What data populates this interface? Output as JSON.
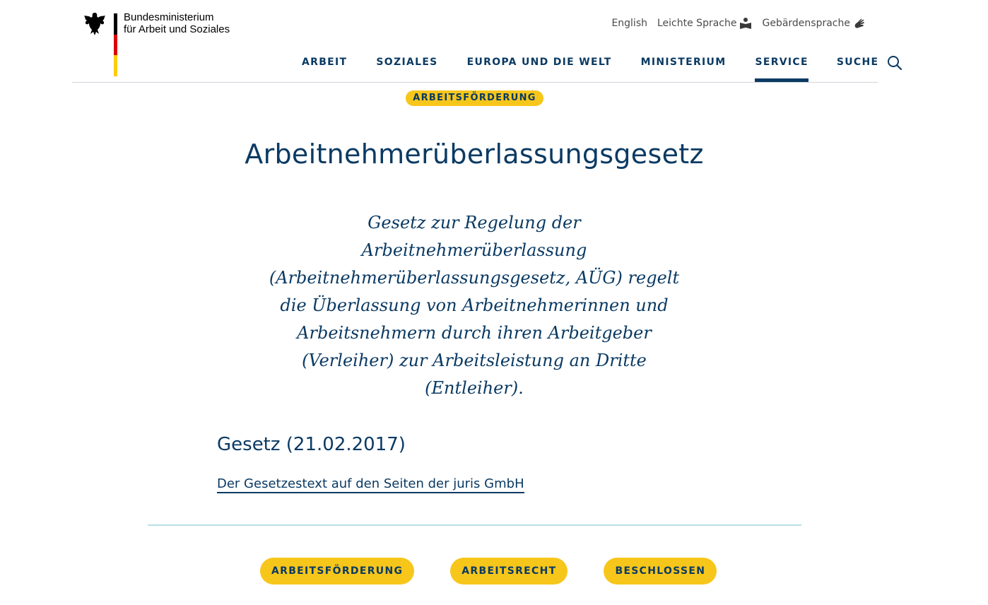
{
  "header": {
    "logo_line1": "Bundesministerium",
    "logo_line2": "für Arbeit und Soziales",
    "lang_links": [
      {
        "label": "English",
        "icon": ""
      },
      {
        "label": "Leichte Sprache",
        "icon": "easy-language-icon"
      },
      {
        "label": "Gebärdensprache",
        "icon": "sign-language-icon"
      }
    ],
    "nav": [
      {
        "label": "ARBEIT"
      },
      {
        "label": "SOZIALES"
      },
      {
        "label": "EUROPA UND DIE WELT"
      },
      {
        "label": "MINISTERIUM"
      },
      {
        "label": "SERVICE",
        "active": true
      },
      {
        "label": "SUCHE"
      }
    ]
  },
  "main": {
    "top_tag": "ARBEITSFÖRDERUNG",
    "title": "Arbeitnehmerüberlassungsgesetz",
    "intro": "Gesetz zur Regelung der Arbeitnehmerüberlassung (Arbeitnehmerüberlassungsgesetz, AÜG) regelt die Überlassung von Arbeitnehmerinnen und Arbeitsnehmern durch ihren Arbeitgeber (Verleiher) zur Arbeitsleistung an Dritte (Entleiher).",
    "law_heading": "Gesetz (21.02.2017)",
    "law_link": "Der Gesetzestext auf den Seiten der juris GmbH",
    "tags": [
      "ARBEITSFÖRDERUNG",
      "ARBEITSRECHT",
      "BESCHLOSSEN"
    ]
  },
  "colors": {
    "primary": "#0a3a63",
    "tag": "#f7c61a",
    "flag_black": "#000000",
    "flag_red": "#dd0000",
    "flag_gold": "#ffcc00",
    "divider": "#b5e0e6"
  }
}
